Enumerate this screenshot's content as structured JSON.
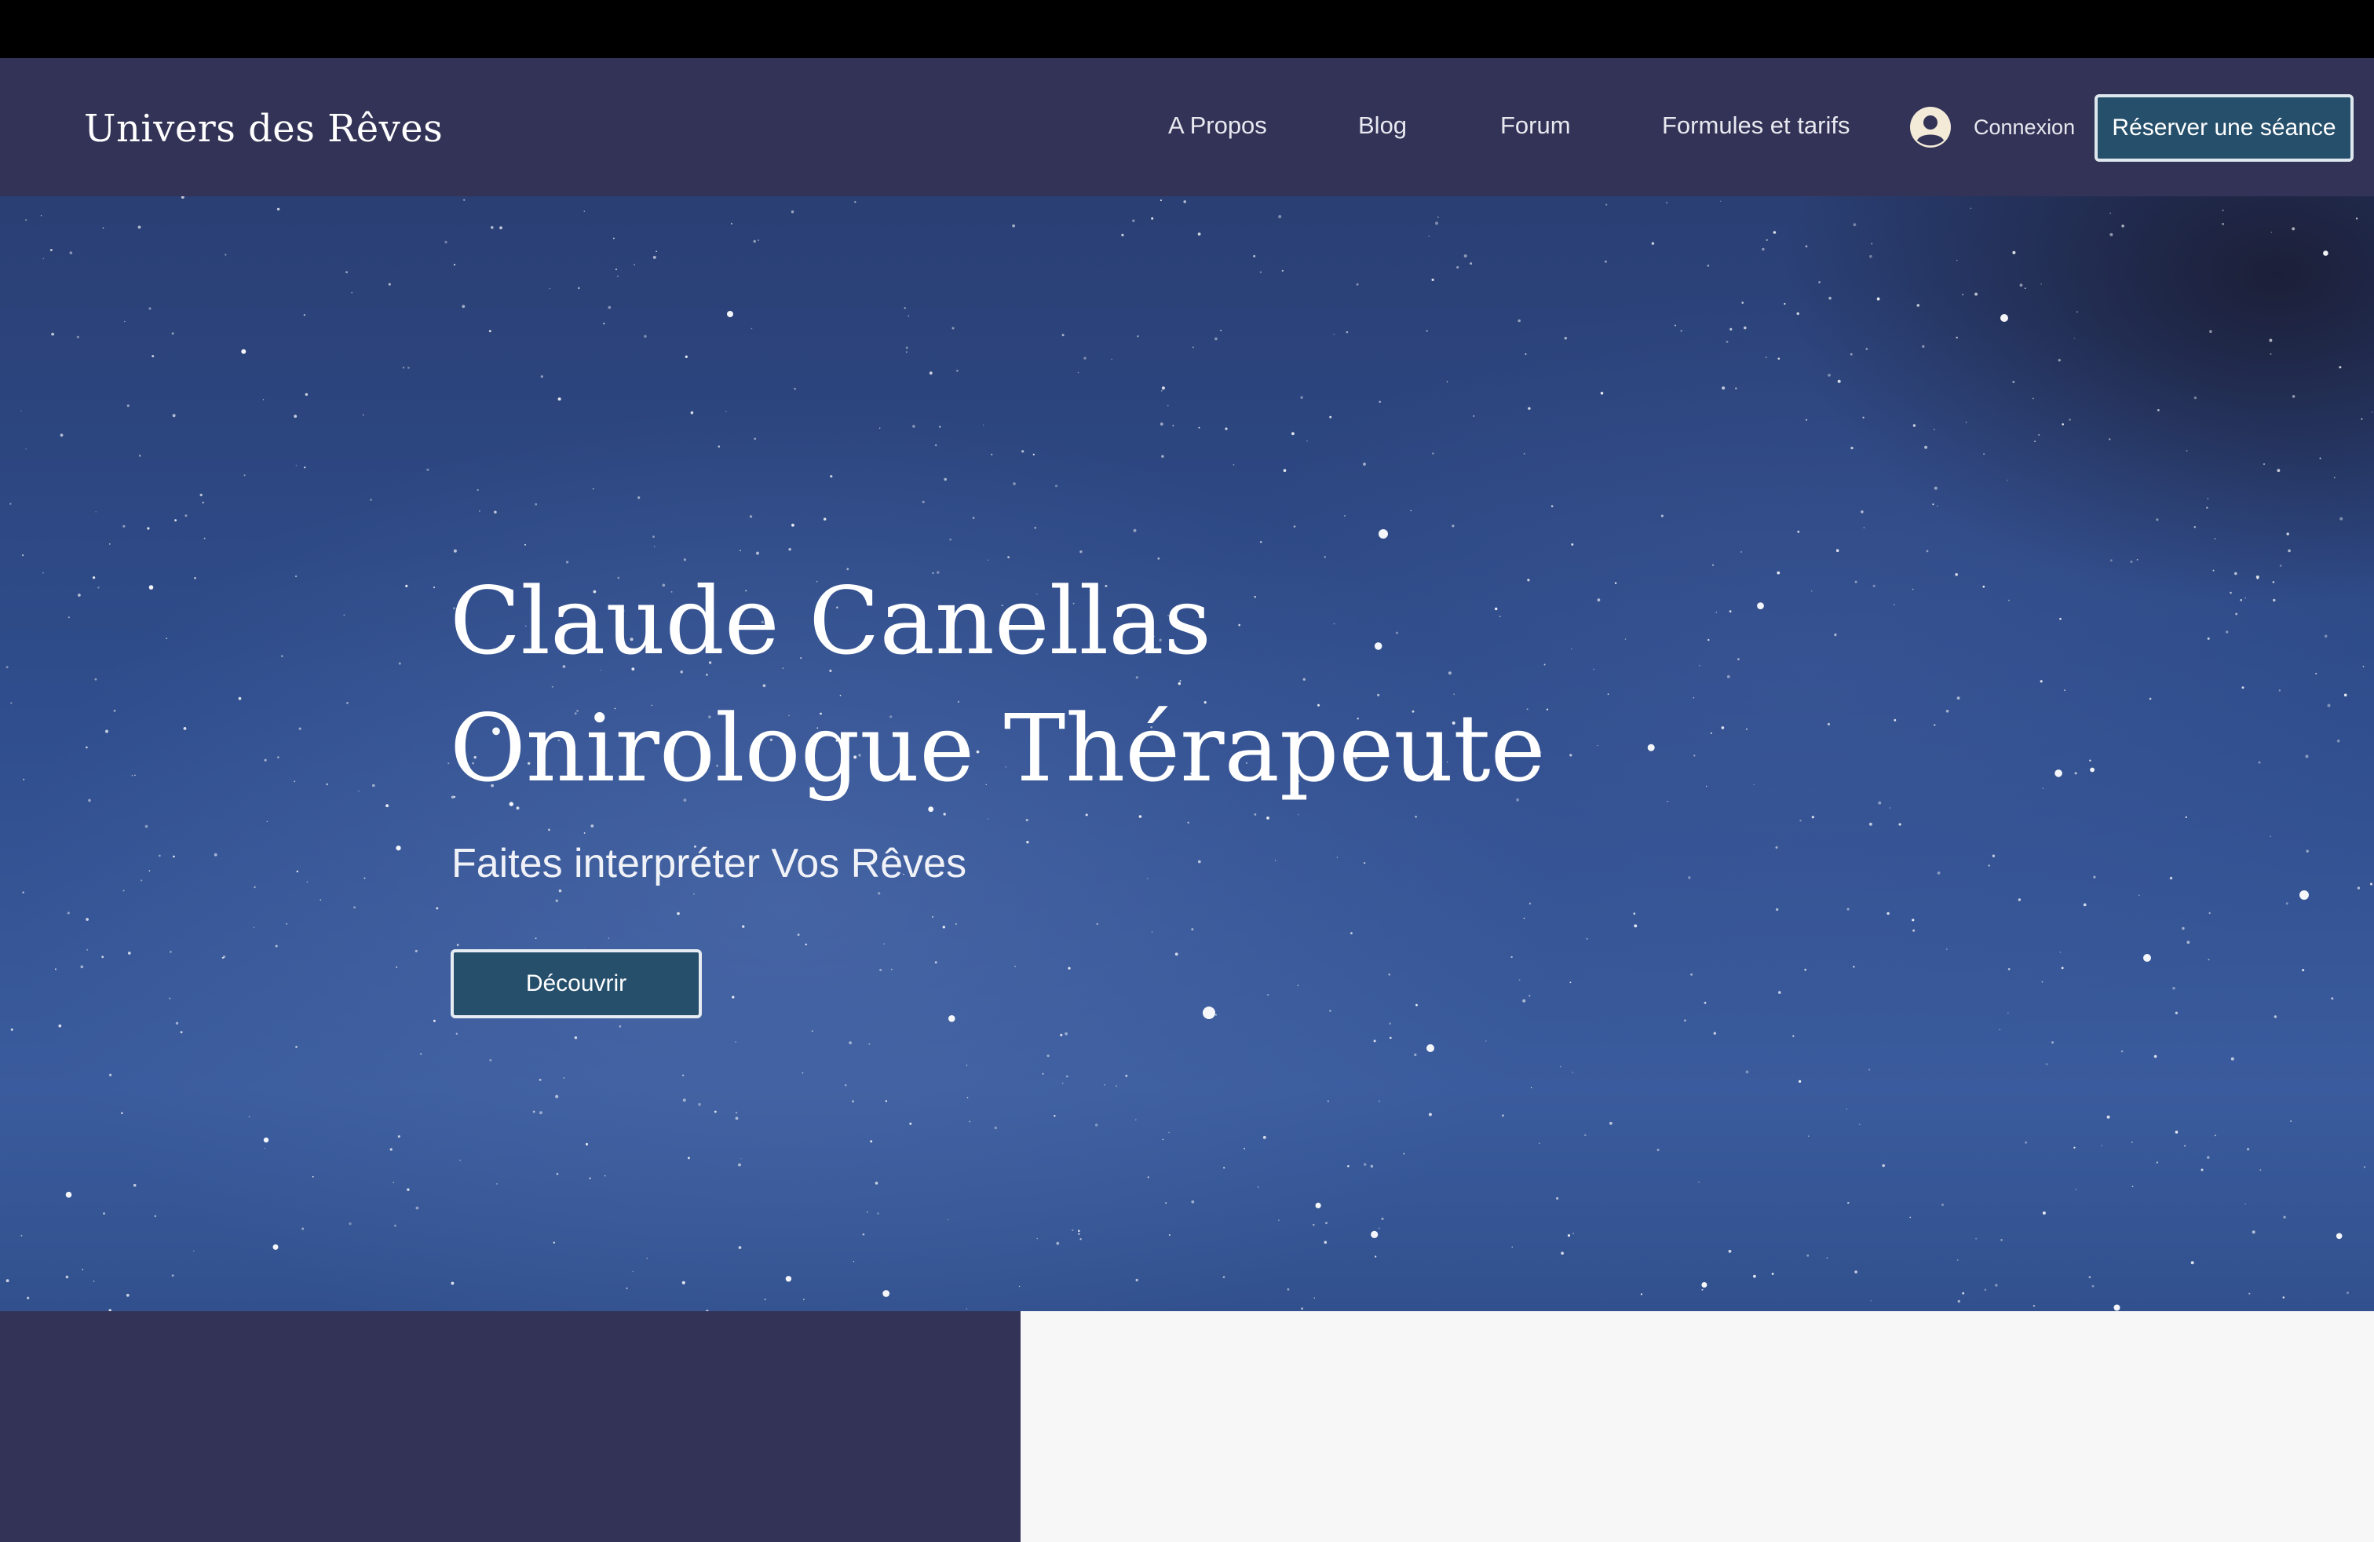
{
  "site": {
    "logo": "Univers des Rêves"
  },
  "nav": {
    "items": [
      {
        "label": "A Propos"
      },
      {
        "label": "Blog"
      },
      {
        "label": "Forum"
      },
      {
        "label": "Formules et tarifs"
      }
    ],
    "login_label": "Connexion",
    "login_icon": "user-avatar-icon",
    "cta_label": "Réserver une séance"
  },
  "hero": {
    "title_line1": "Claude Canellas",
    "title_line2": "Onirologue Thérapeute",
    "subtitle": "Faites interpréter Vos Rêves",
    "button_label": "Découvrir",
    "background": "starry-night-sky-image"
  },
  "colors": {
    "header_bg": "#333357",
    "button_bg": "#264f6b",
    "button_border": "#dfe7ee",
    "text_light": "#ffffff",
    "panel_light": "#f7f7f7"
  }
}
